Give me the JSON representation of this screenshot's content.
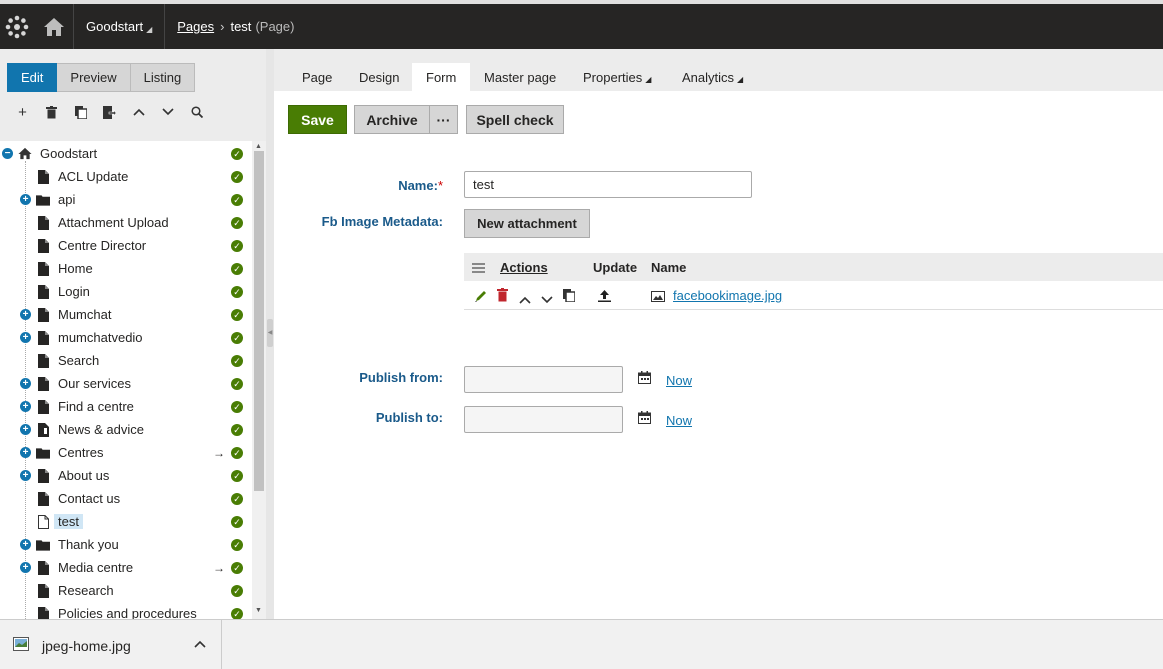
{
  "header": {
    "site": "Goodstart",
    "crumb_link": "Pages",
    "crumb_page": "test",
    "crumb_type": "(Page)"
  },
  "modes": [
    "Edit",
    "Preview",
    "Listing"
  ],
  "tree_tools": [
    "add-icon",
    "delete-icon",
    "copy-icon",
    "move-icon",
    "up-icon",
    "down-icon",
    "search-icon"
  ],
  "tree": [
    {
      "label": "Goodstart",
      "icon": "home",
      "root": true,
      "expander": "minus"
    },
    {
      "label": "ACL Update",
      "icon": "page"
    },
    {
      "label": "api",
      "icon": "folder",
      "expander": "plus"
    },
    {
      "label": "Attachment Upload",
      "icon": "page"
    },
    {
      "label": "Centre Director",
      "icon": "page"
    },
    {
      "label": "Home",
      "icon": "page"
    },
    {
      "label": "Login",
      "icon": "page"
    },
    {
      "label": "Mumchat",
      "icon": "page",
      "expander": "plus"
    },
    {
      "label": "mumchatvedio",
      "icon": "page",
      "expander": "plus"
    },
    {
      "label": "Search",
      "icon": "page"
    },
    {
      "label": "Our services",
      "icon": "page",
      "expander": "plus"
    },
    {
      "label": "Find a centre",
      "icon": "page",
      "expander": "plus"
    },
    {
      "label": "News & advice",
      "icon": "page-alt",
      "expander": "plus"
    },
    {
      "label": "Centres",
      "icon": "folder",
      "expander": "plus",
      "link": true
    },
    {
      "label": "About us",
      "icon": "page",
      "expander": "plus"
    },
    {
      "label": "Contact us",
      "icon": "page"
    },
    {
      "label": "test",
      "icon": "page-empty",
      "selected": true
    },
    {
      "label": "Thank you",
      "icon": "folder",
      "expander": "plus"
    },
    {
      "label": "Media centre",
      "icon": "page",
      "expander": "plus",
      "link": true
    },
    {
      "label": "Research",
      "icon": "page"
    },
    {
      "label": "Policies and procedures",
      "icon": "page"
    }
  ],
  "content_tabs": [
    {
      "label": "Page"
    },
    {
      "label": "Design"
    },
    {
      "label": "Form",
      "active": true
    },
    {
      "label": "Master page"
    },
    {
      "label": "Properties",
      "dropdown": true
    },
    {
      "label": "Analytics",
      "dropdown": true
    }
  ],
  "toolbar": {
    "save": "Save",
    "archive": "Archive",
    "more": "···",
    "spell": "Spell check"
  },
  "form": {
    "name_label": "Name:",
    "name_required": "*",
    "name_value": "test",
    "fb_label": "Fb Image Metadata:",
    "new_attachment": "New attachment",
    "grid_headers": {
      "actions": "Actions",
      "update": "Update",
      "name": "Name"
    },
    "attachment_file": "facebookimage.jpg",
    "publish_from_label": "Publish from:",
    "publish_to_label": "Publish to:",
    "publish_from_value": "",
    "publish_to_value": "",
    "now": "Now"
  },
  "download": {
    "file": "jpeg-home.jpg"
  },
  "colors": {
    "accent": "#1175ae",
    "save": "#497d04",
    "header": "#262524",
    "label": "#1a5a8a"
  }
}
